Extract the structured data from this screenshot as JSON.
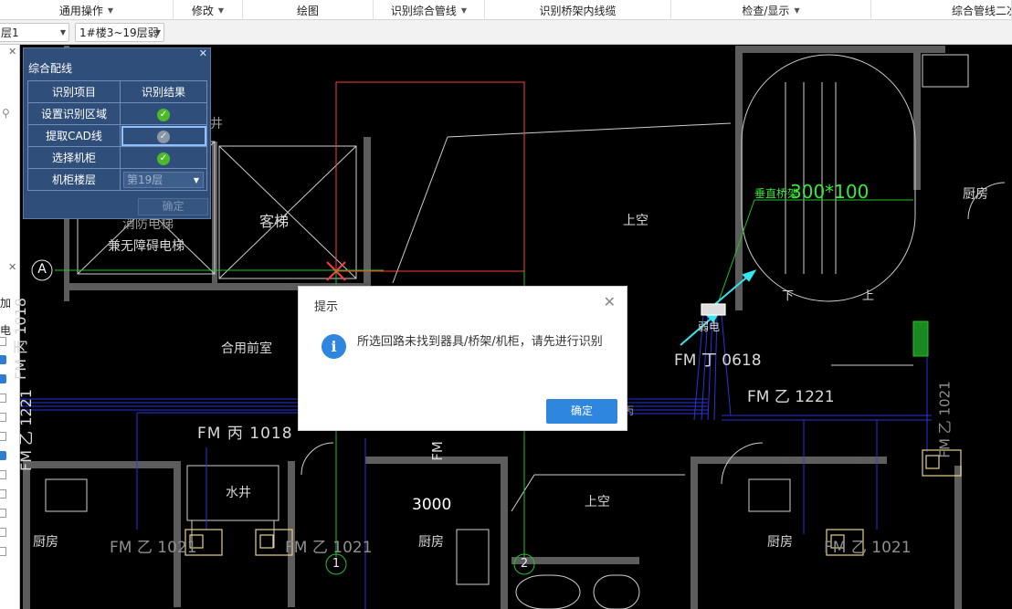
{
  "menubar": {
    "items": [
      {
        "label": "通用操作",
        "dropdown": true
      },
      {
        "label": "修改",
        "dropdown": true
      },
      {
        "label": "绘图",
        "dropdown": false
      },
      {
        "label": "识别综合管线",
        "dropdown": true
      },
      {
        "label": "识别桥架内线缆",
        "dropdown": false
      },
      {
        "label": "检查/显示",
        "dropdown": true
      },
      {
        "label": "综合管线二次",
        "dropdown": false
      }
    ]
  },
  "subbar": {
    "floor_combo": "层1",
    "building_combo": "1#楼3~19层弱"
  },
  "left_strip": {
    "label_add": "加",
    "label_elec": "电"
  },
  "panel": {
    "title": "综合配线",
    "header_item": "识别项目",
    "header_result": "识别结果",
    "rows": [
      {
        "label": "设置识别区域",
        "status": "done"
      },
      {
        "label": "提取CAD线",
        "status": "pending"
      },
      {
        "label": "选择机柜",
        "status": "done"
      },
      {
        "label": "机柜楼层",
        "status": "select"
      }
    ],
    "floor_value": "第19层",
    "ok_label": "确定"
  },
  "dialog": {
    "title": "提示",
    "message": "所选回路未找到器具/桥架/机柜，请先进行识别",
    "ok_label": "确定"
  },
  "cad": {
    "axis_a": "A",
    "axis_1": "1",
    "axis_2": "2",
    "label_keti": "客梯",
    "label_wuzhangai": "兼无障碍电梯",
    "label_xiaofang": "消防电梯",
    "label_heyong": "合用前室",
    "label_shangkong1": "上空",
    "label_shangkong2": "上空",
    "label_shuijing": "水井",
    "label_chufang_left": "厨房",
    "label_chufang_mid": "厨房",
    "label_chufang_right": "厨房",
    "label_chufang_top": "厨房",
    "label_fm_bing_1018_v": "FM 丙 1018",
    "label_fm_bing_1018_h": "FM 丙 1018",
    "label_fm_yi_1221_v": "FM 乙 1221",
    "label_fm_yi_1221_r": "FM 乙 1221",
    "label_fm_yi_1021_a": "FM 乙 1021",
    "label_fm_yi_1021_b": "FM 乙 1021",
    "label_fm_yi_1021_c": "FM 乙 1021",
    "label_fm_yi_1021_v": "FM 乙 1021",
    "label_fm_0618": "FM 丁 0618",
    "label_fm_v2": "FM",
    "label_3000": "3000",
    "label_chuizhi": "垂直桥架",
    "label_300x100": "300*100",
    "label_xia": "下",
    "label_shang": "上",
    "label_ruodian": "弱电",
    "label_jing": "井",
    "label_bing": "丙"
  }
}
